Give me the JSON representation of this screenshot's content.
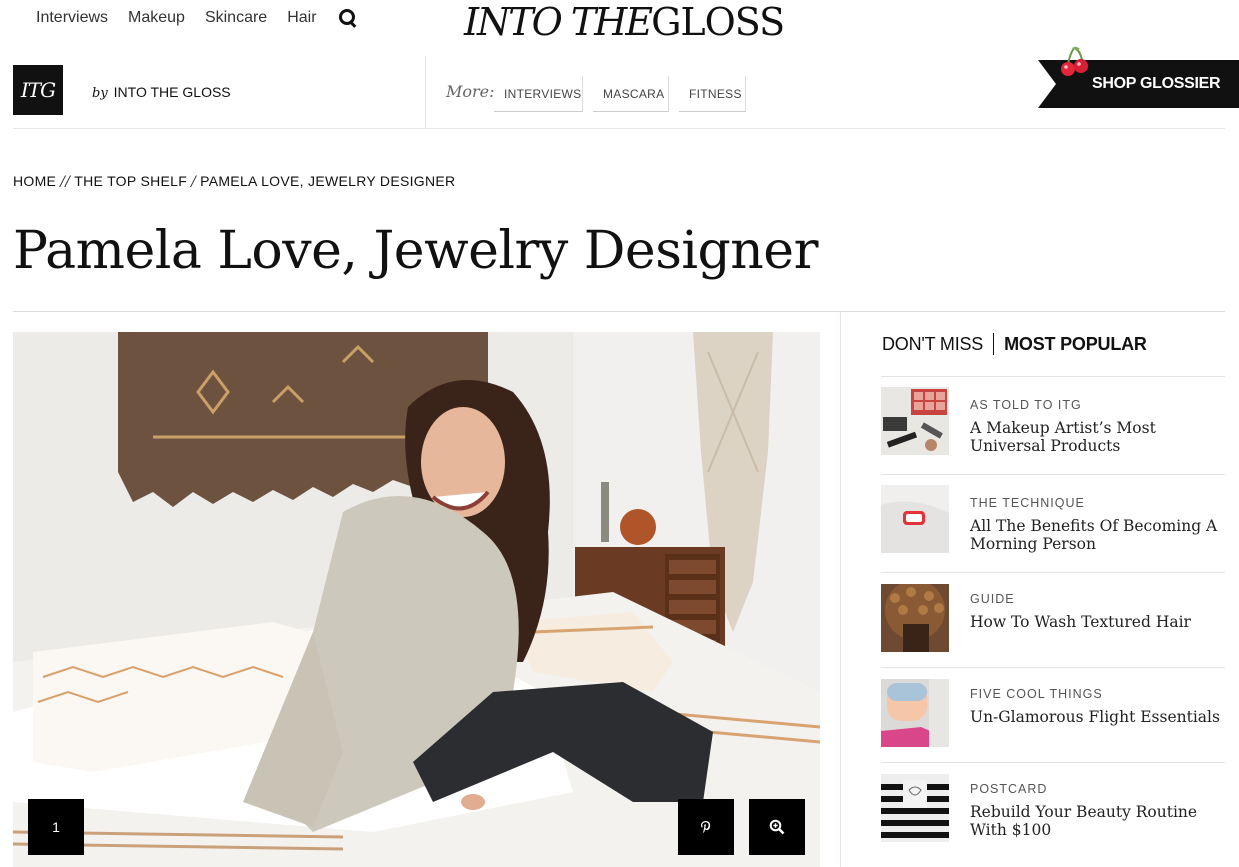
{
  "topnav": {
    "items": [
      "Interviews",
      "Makeup",
      "Skincare",
      "Hair"
    ],
    "search_icon": "search-icon"
  },
  "logo": {
    "part1": "INTO THE",
    "part2": "GLOSS"
  },
  "subbar": {
    "badge": "ITG",
    "by": "by",
    "byline": "INTO THE GLOSS",
    "more_label": "More:",
    "tags": [
      "INTERVIEWS",
      "MASCARA",
      "FITNESS"
    ]
  },
  "shop": {
    "label": "SHOP GLOSSIER",
    "icon": "cherry-icon"
  },
  "breadcrumb": {
    "items": [
      "HOME",
      "THE TOP SHELF",
      "PAMELA LOVE, JEWELRY DESIGNER"
    ],
    "sep1": "//",
    "sep2": "/"
  },
  "page": {
    "title": "Pamela Love, Jewelry Designer"
  },
  "hero": {
    "slide_number": "1",
    "pin_icon": "pinterest-icon",
    "zoom_icon": "zoom-in-icon"
  },
  "sidebar": {
    "tab_dont_miss": "DON'T MISS",
    "tab_most_popular": "MOST POPULAR",
    "items": [
      {
        "kicker": "AS TOLD TO ITG",
        "headline": "A Makeup Artist’s Most Universal Products"
      },
      {
        "kicker": "THE TECHNIQUE",
        "headline": "All The Benefits Of Becoming A Morning Person"
      },
      {
        "kicker": "GUIDE",
        "headline": "How To Wash Textured Hair"
      },
      {
        "kicker": "FIVE COOL THINGS",
        "headline": "Un-Glamorous Flight Essentials"
      },
      {
        "kicker": "POSTCARD",
        "headline": "Rebuild Your Beauty Routine With $100"
      }
    ]
  }
}
